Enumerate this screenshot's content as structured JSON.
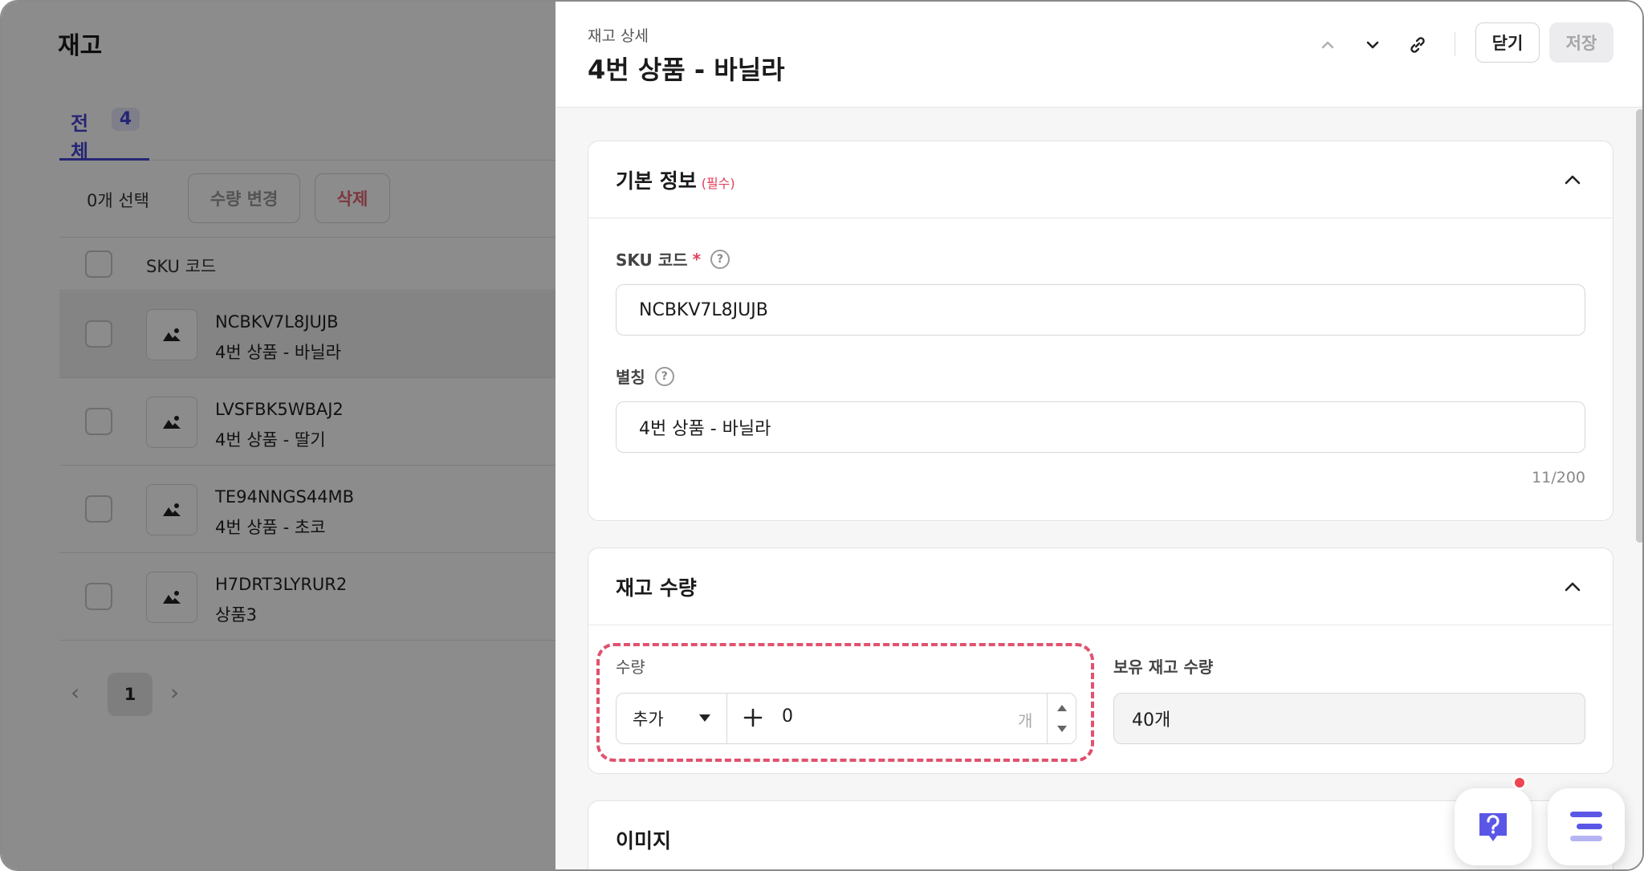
{
  "list": {
    "title": "재고",
    "tab": {
      "label": "전체",
      "count": "4"
    },
    "selected_count": "0개 선택",
    "bulk_qty_button": "수량 변경",
    "delete_button": "삭제",
    "column_sku": "SKU 코드",
    "rows": [
      {
        "sku": "NCBKV7L8JUJB",
        "name": "4번 상품 - 바닐라"
      },
      {
        "sku": "LVSFBK5WBAJ2",
        "name": "4번 상품 - 딸기"
      },
      {
        "sku": "TE94NNGS44MB",
        "name": "4번 상품 - 초코"
      },
      {
        "sku": "H7DRT3LYRUR2",
        "name": "상품3"
      }
    ],
    "pagination": {
      "prev": "‹",
      "current": "1",
      "next": "›"
    }
  },
  "drawer": {
    "subtitle": "재고 상세",
    "title": "4번 상품 - 바닐라",
    "close_button": "닫기",
    "save_button": "저장",
    "basic_info": {
      "title": "기본 정보",
      "required_tag": "(필수)",
      "sku_label": "SKU 코드",
      "sku_required_mark": "*",
      "sku_value": "NCBKV7L8JUJB",
      "alias_label": "별칭",
      "alias_value": "4번 상품 - 바닐라",
      "alias_counter": "11/200",
      "help_glyph": "?"
    },
    "stock": {
      "title": "재고 수량",
      "qty_label": "수량",
      "mode_value": "추가",
      "qty_value": "0",
      "qty_unit": "개",
      "owned_label": "보유 재고 수량",
      "owned_value": "40개"
    },
    "image_section": {
      "title": "이미지"
    }
  },
  "colors": {
    "accent": "#4846d6",
    "danger": "#e46474",
    "highlight_dash": "#e0526e",
    "fab_icon": "#5b57e6",
    "notification": "#ef4452"
  },
  "icons": {
    "prev": "chevron-up-icon",
    "next": "chevron-down-icon",
    "link": "link-icon",
    "collapse": "chevron-up-icon",
    "help_fab": "question-chat-icon",
    "menu_fab": "menu-lines-icon"
  }
}
